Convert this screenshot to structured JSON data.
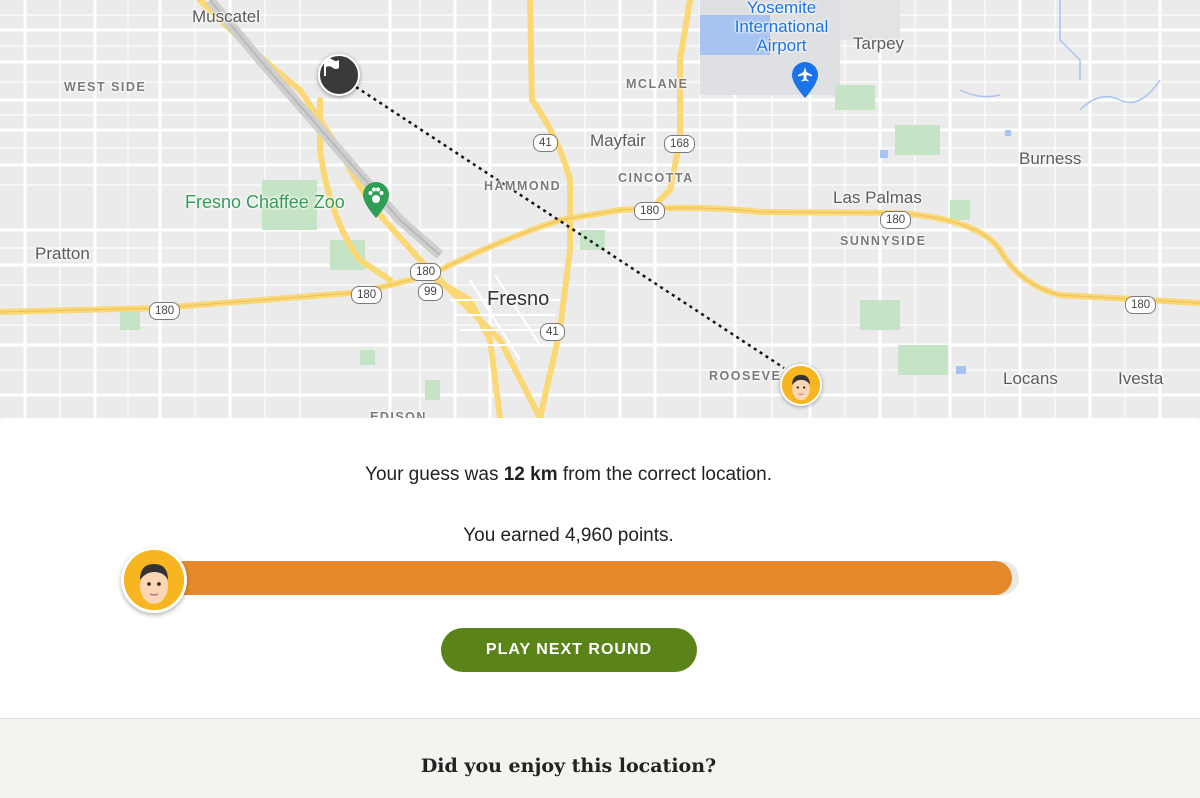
{
  "map": {
    "places": {
      "muscatel": "Muscatel",
      "west_side": "WEST SIDE",
      "pratton": "Pratton",
      "mclane": "MCLANE",
      "mayfair": "Mayfair",
      "hammond": "HAMMOND",
      "cincotta": "CINCOTTA",
      "fresno": "Fresno",
      "las_palmas": "Las Palmas",
      "sunnyside": "SUNNYSIDE",
      "burness": "Burness",
      "tarpey": "Tarpey",
      "roosevelt": "ROOSEVE",
      "locans": "Locans",
      "ivesta": "Ivesta",
      "edison": "EDISON"
    },
    "poi": {
      "airport_line1": "Yosemite",
      "airport_line2": "International",
      "airport_line3": "Airport",
      "zoo": "Fresno Chaffee Zoo"
    },
    "shields": {
      "r41a": "41",
      "r168": "168",
      "r180a": "180",
      "r180b": "180",
      "r180c": "180",
      "r180d": "180",
      "r180e": "180",
      "r180f": "180",
      "r99": "99",
      "r41b": "41"
    }
  },
  "result": {
    "distance_prefix": "Your guess was",
    "distance_value": "12 km",
    "distance_suffix": "from the correct location.",
    "points_text": "You earned 4,960 points.",
    "score_fraction": 0.992,
    "next_button": "PLAY NEXT ROUND"
  },
  "feedback": {
    "question": "Did you enjoy this location?"
  },
  "colors": {
    "progress": "#e5882b",
    "button": "#5a8418",
    "avatar": "#f7b51f"
  },
  "icons": {
    "flag": "flag-icon",
    "player": "player-avatar-icon",
    "airport": "airplane-icon",
    "zoo": "paw-icon"
  }
}
